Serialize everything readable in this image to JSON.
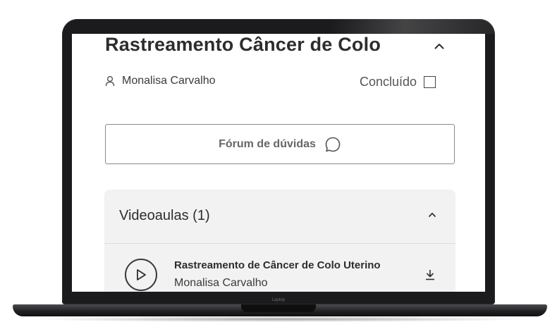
{
  "course": {
    "title": "Rastreamento Câncer de Colo",
    "author": "Monalisa Carvalho",
    "completed_label": "Concluído",
    "completed": false
  },
  "forum": {
    "label": "Fórum de dúvidas"
  },
  "videos": {
    "header": "Videoaulas (1)",
    "items": [
      {
        "title": "Rastreamento de Câncer de Colo Uterino",
        "author": "Monalisa Carvalho"
      }
    ]
  },
  "device": {
    "label": "Laptop"
  },
  "colors": {
    "text": "#2d2d2d",
    "panel": "#f2f2f3",
    "border": "#8a8a8a",
    "bezel": "#1b1b1d"
  },
  "icons": {
    "author": "user-icon",
    "collapse": "chevron-up-icon",
    "forum": "chat-bubble-icon",
    "play": "play-icon",
    "download": "download-icon"
  }
}
